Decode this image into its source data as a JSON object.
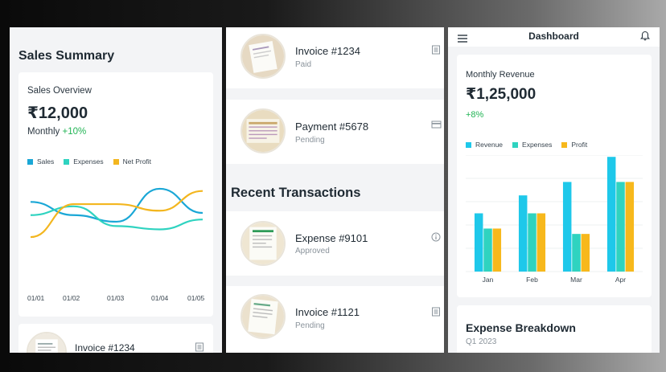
{
  "panel1": {
    "heading": "Sales Summary",
    "card_title": "Sales Overview",
    "amount": "₹12,000",
    "period_label": "Monthly",
    "change": "+10%",
    "legend": [
      {
        "name": "Sales",
        "color": "#1aa7d6"
      },
      {
        "name": "Expenses",
        "color": "#2fd3c0"
      },
      {
        "name": "Net Profit",
        "color": "#f3b61f"
      }
    ],
    "x_ticks": [
      "01/01",
      "01/02",
      "01/03",
      "01/04",
      "01/05"
    ],
    "bottom_item": {
      "title": "Invoice #1234",
      "icon": "document-icon"
    }
  },
  "panel2": {
    "items_top": [
      {
        "title": "Invoice #1234",
        "status": "Paid",
        "icon": "document-icon"
      },
      {
        "title": "Payment #5678",
        "status": "Pending",
        "icon": "credit-card-icon"
      }
    ],
    "section_heading": "Recent Transactions",
    "items_bottom": [
      {
        "title": "Expense #9101",
        "status": "Approved",
        "icon": "info-icon"
      },
      {
        "title": "Invoice #1121",
        "status": "Pending",
        "icon": "document-icon"
      }
    ]
  },
  "panel3": {
    "app_title": "Dashboard",
    "card_title": "Monthly Revenue",
    "amount": "₹1,25,000",
    "change": "+8%",
    "breakdown_title": "Expense Breakdown",
    "breakdown_period": "Q1 2023"
  },
  "chart_data": [
    {
      "type": "line",
      "x": [
        "01/01",
        "01/02",
        "01/03",
        "01/04",
        "01/05"
      ],
      "series": [
        {
          "name": "Sales",
          "values": [
            40,
            28,
            22,
            52,
            30
          ]
        },
        {
          "name": "Expenses",
          "values": [
            28,
            36,
            18,
            15,
            24
          ]
        },
        {
          "name": "Net Profit",
          "values": [
            8,
            38,
            38,
            32,
            50
          ]
        }
      ],
      "grid": false,
      "legend": "top-left"
    },
    {
      "type": "bar",
      "categories": [
        "Jan",
        "Feb",
        "Mar",
        "Apr"
      ],
      "series": [
        {
          "name": "Revenue",
          "values": [
            65,
            85,
            100,
            128
          ]
        },
        {
          "name": "Expenses",
          "values": [
            48,
            65,
            42,
            100
          ]
        },
        {
          "name": "Profit",
          "values": [
            48,
            65,
            42,
            100
          ]
        }
      ],
      "colors": [
        "#1ec8ea",
        "#2fd3c0",
        "#f7b81c"
      ],
      "grid": true,
      "legend": "top-left"
    }
  ]
}
